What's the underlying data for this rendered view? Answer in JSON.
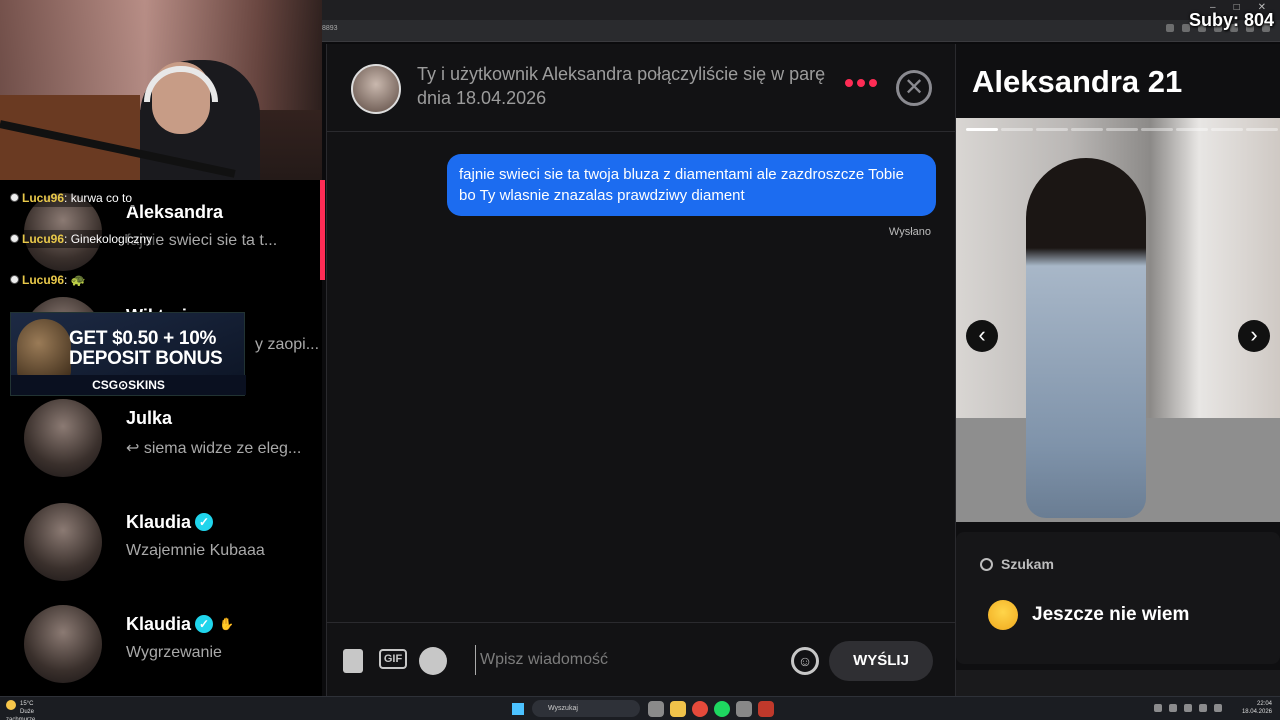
{
  "stream": {
    "subs": "Suby: 804"
  },
  "browser": {
    "url_fragment": "8893"
  },
  "chat_overlay": [
    {
      "user": "Lucu96",
      "text": "kurwa co to"
    },
    {
      "user": "Lucu96",
      "text": "Ginekologiczny"
    },
    {
      "user": "Lucu96",
      "text": ""
    }
  ],
  "ad": {
    "line1": "GET $0.50 + 10%",
    "line2": "DEPOSIT BONUS",
    "brand": "CSG⊙SKINS"
  },
  "matches": [
    {
      "name": "Aleksandra",
      "preview": "fajnie swieci sie ta t...",
      "verified": false
    },
    {
      "name": "Wiktoria",
      "preview": "y zaopi...",
      "verified": false
    },
    {
      "name": "Julka",
      "preview": "↩ siema widze ze eleg...",
      "verified": false
    },
    {
      "name": "Klaudia",
      "preview": "Wzajemnie Kubaaa",
      "verified": true
    },
    {
      "name": "Klaudia",
      "preview": "Wygrzewanie",
      "verified": true
    }
  ],
  "conversation": {
    "header": "Ty i użytkownik Aleksandra połączyliście się w parę dnia 18.04.2026",
    "message": "fajnie swieci sie ta twoja bluza z diamentami ale zazdroszcze Tobie bo Ty wlasnie znazalas prawdziwy diament",
    "status": "Wysłano",
    "input_placeholder": "Wpisz wiadomość",
    "send_label": "WYŚLIJ",
    "gif_label": "GIF"
  },
  "profile": {
    "name_age": "Aleksandra 21",
    "looking_label": "Szukam",
    "looking_value": "Jeszcze nie wiem"
  },
  "taskbar": {
    "weather_temp": "15°C",
    "weather_desc": "Duże zachmurze...",
    "search_label": "Wyszukaj",
    "time": "22:04",
    "date": "18.04.2026"
  },
  "colors": {
    "accent": "#fe2c55",
    "bubble": "#1c6cf0",
    "verified": "#20d5ec"
  }
}
